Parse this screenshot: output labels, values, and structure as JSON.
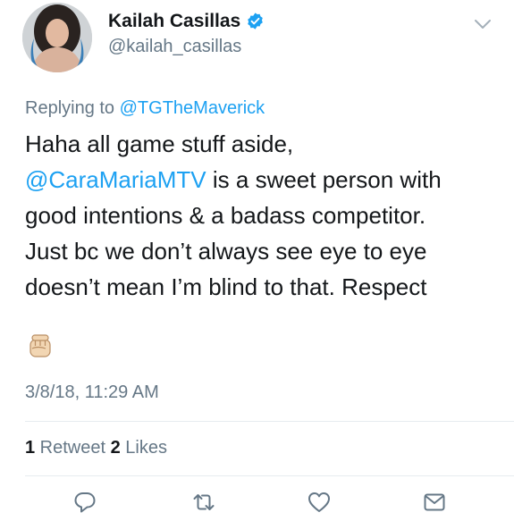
{
  "author": {
    "name": "Kailah Casillas",
    "handle": "@kailah_casillas"
  },
  "replying": {
    "prefix": "Replying to ",
    "to": "@TGTheMaverick"
  },
  "tweet": {
    "line1": "Haha all game stuff aside,",
    "mention": "@CaraMariaMTV",
    "line2_rest": " is a sweet person with",
    "line3": "good intentions & a badass competitor.",
    "line4": "Just bc we don’t always see eye to eye",
    "line5": "doesn’t mean I’m blind to that. Respect",
    "emoji": "✊"
  },
  "timestamp": "3/8/18, 11:29 AM",
  "stats": {
    "retweets": "1",
    "retweets_label": " Retweet ",
    "likes": "2",
    "likes_label": " Likes"
  },
  "colors": {
    "link": "#1da1f2",
    "secondary": "#657786",
    "divider": "#e6ecf0",
    "skin": "#f2d6b3"
  },
  "icons": [
    "verified-badge-icon",
    "chevron-down-icon",
    "reply-icon",
    "retweet-icon",
    "like-icon",
    "message-icon",
    "raised-fist-icon"
  ]
}
